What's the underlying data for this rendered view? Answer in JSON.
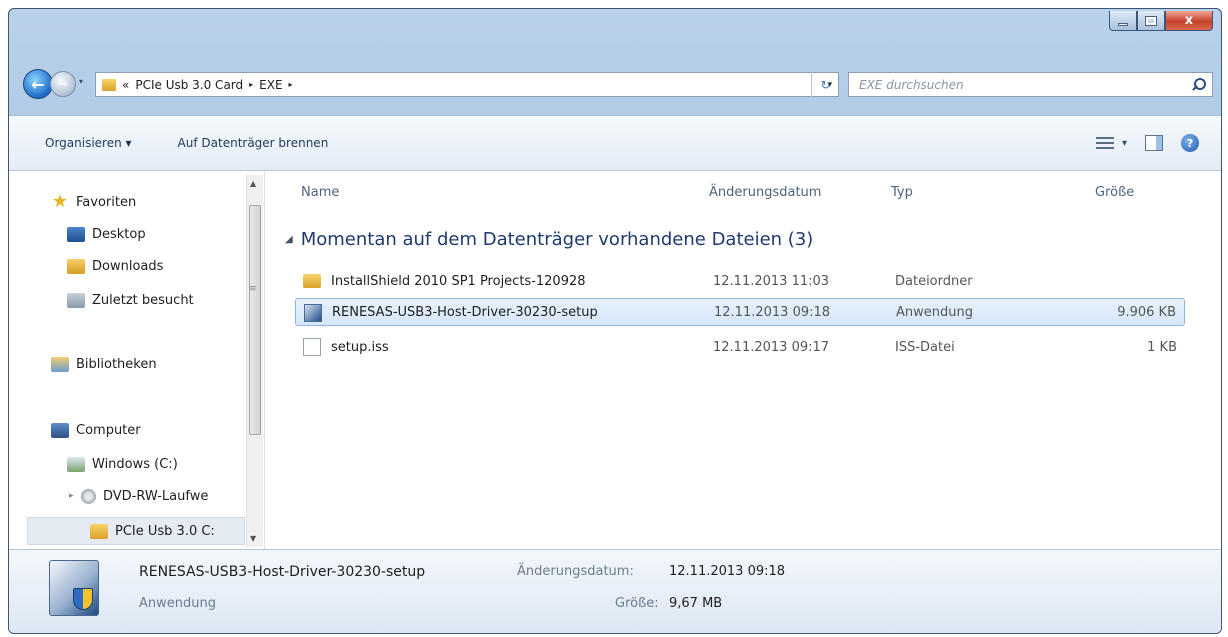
{
  "window": {
    "close_glyph": "x"
  },
  "address_bar": {
    "overflow": "«",
    "crumbs": [
      "PCIe Usb 3.0 Card",
      "EXE"
    ],
    "separator": "▸",
    "dropdown": "▾",
    "refresh": "↻",
    "search_placeholder": "EXE durchsuchen"
  },
  "toolbar": {
    "organize": "Organisieren ▾",
    "burn": "Auf Datenträger brennen",
    "views_drop": "▾",
    "help": "?"
  },
  "nav": {
    "items": [
      {
        "label": "Favoriten",
        "icon": "star-icon"
      },
      {
        "label": "Desktop",
        "icon": "desktop-icon"
      },
      {
        "label": "Downloads",
        "icon": "downloads-folder-icon"
      },
      {
        "label": "Zuletzt besucht",
        "icon": "recent-places-icon"
      },
      {
        "label": "Bibliotheken",
        "icon": "libraries-icon"
      },
      {
        "label": "Computer",
        "icon": "computer-icon"
      },
      {
        "label": "Windows (C:)",
        "icon": "drive-icon"
      },
      {
        "label": "DVD-RW-Laufwe",
        "icon": "dvd-drive-icon"
      },
      {
        "label": "PCIe Usb 3.0 C:",
        "icon": "folder-icon"
      }
    ]
  },
  "columns": {
    "name": "Name",
    "date": "Änderungsdatum",
    "type": "Typ",
    "size": "Größe"
  },
  "group": {
    "label": "Momentan auf dem Datenträger vorhandene Dateien (3)"
  },
  "files": [
    {
      "name": "InstallShield 2010 SP1 Projects-120928",
      "date": "12.11.2013 11:03",
      "type": "Dateiordner",
      "size": "",
      "icon": "folder-icon"
    },
    {
      "name": "RENESAS-USB3-Host-Driver-30230-setup",
      "date": "12.11.2013 09:18",
      "type": "Anwendung",
      "size": "9.906 KB",
      "icon": "application-icon"
    },
    {
      "name": "setup.iss",
      "date": "12.11.2013 09:17",
      "type": "ISS-Datei",
      "size": "1 KB",
      "icon": "iss-file-icon"
    }
  ],
  "details": {
    "name": "RENESAS-USB3-Host-Driver-30230-setup",
    "type": "Anwendung",
    "date_label": "Änderungsdatum:",
    "date": "12.11.2013 09:18",
    "size_label": "Größe:",
    "size": "9,67 MB"
  },
  "colors": {
    "frame": "#b9d1ea",
    "selection": "#d5e7fa",
    "group_header": "#1e3a6e"
  }
}
